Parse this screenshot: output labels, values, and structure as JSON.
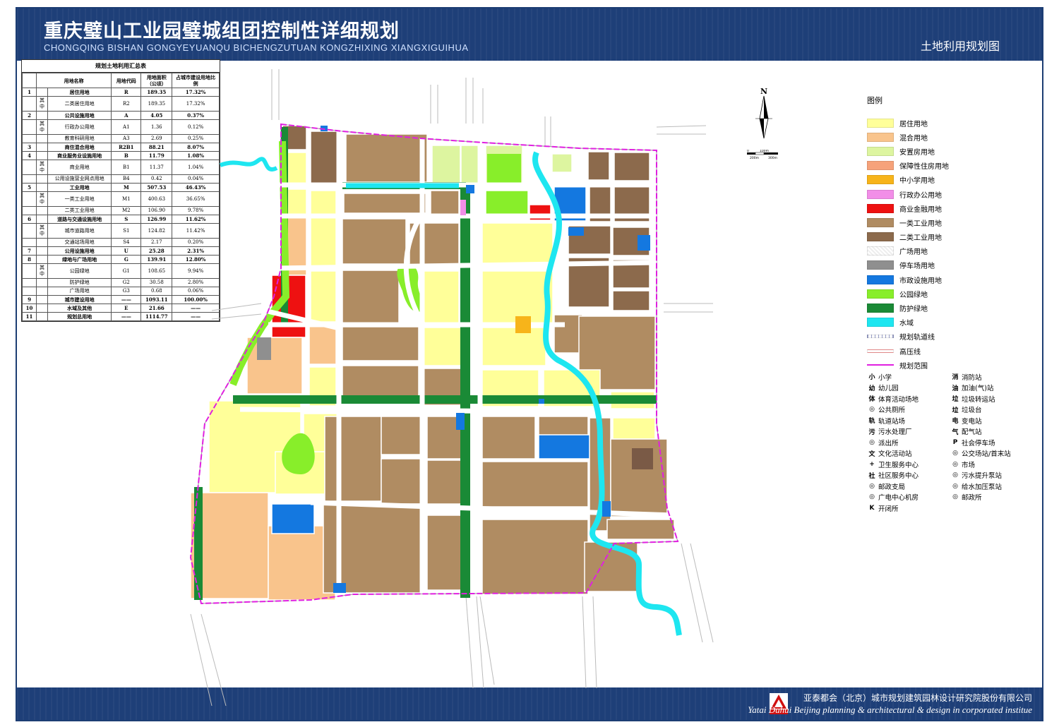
{
  "header": {
    "title_cn": "重庆璧山工业园璧城组团控制性详细规划",
    "title_en": "CHONGQING BISHAN GONGYEYUANQU BICHENGZUTUAN KONGZHIXING XIANGXIGUIHUA",
    "subtitle": "土地利用规划图"
  },
  "footer": {
    "org_cn": "亚泰都会（北京）城市规划建筑园林设计研究院股份有限公司",
    "org_en": "Yatai Duhui Beijing planning & architectural & design in corporated institue",
    "logo_text": "DUHUI"
  },
  "summary": {
    "caption": "规划土地利用汇总表",
    "headers": [
      "用地名称",
      "用地代码",
      "用地面积（公顷）",
      "占城市建设用地比例"
    ],
    "rows": [
      {
        "no": "1",
        "sub": "",
        "name": "居住用地",
        "code": "R",
        "area": "189.35",
        "ratio": "17.32%",
        "main": true
      },
      {
        "no": "",
        "sub": "其中",
        "name": "二类居住用地",
        "code": "R2",
        "area": "189.35",
        "ratio": "17.32%",
        "main": false
      },
      {
        "no": "2",
        "sub": "",
        "name": "公共设施用地",
        "code": "A",
        "area": "4.05",
        "ratio": "0.37%",
        "main": true
      },
      {
        "no": "",
        "sub": "其中",
        "name": "行政办公用地",
        "code": "A1",
        "area": "1.36",
        "ratio": "0.12%",
        "main": false
      },
      {
        "no": "",
        "sub": "",
        "name": "教育科研用地",
        "code": "A3",
        "area": "2.69",
        "ratio": "0.25%",
        "main": false
      },
      {
        "no": "3",
        "sub": "",
        "name": "商住混合用地",
        "code": "R2B1",
        "area": "88.21",
        "ratio": "8.07%",
        "main": true
      },
      {
        "no": "4",
        "sub": "",
        "name": "商业服务业设施用地",
        "code": "B",
        "area": "11.79",
        "ratio": "1.08%",
        "main": true
      },
      {
        "no": "",
        "sub": "其中",
        "name": "商业用地",
        "code": "B1",
        "area": "11.37",
        "ratio": "1.04%",
        "main": false
      },
      {
        "no": "",
        "sub": "",
        "name": "公用设施营业网点用地",
        "code": "B4",
        "area": "0.42",
        "ratio": "0.04%",
        "main": false
      },
      {
        "no": "5",
        "sub": "",
        "name": "工业用地",
        "code": "M",
        "area": "507.53",
        "ratio": "46.43%",
        "main": true
      },
      {
        "no": "",
        "sub": "其中",
        "name": "一类工业用地",
        "code": "M1",
        "area": "400.63",
        "ratio": "36.65%",
        "main": false
      },
      {
        "no": "",
        "sub": "",
        "name": "二类工业用地",
        "code": "M2",
        "area": "106.90",
        "ratio": "9.78%",
        "main": false
      },
      {
        "no": "6",
        "sub": "",
        "name": "道路与交通设施用地",
        "code": "S",
        "area": "126.99",
        "ratio": "11.62%",
        "main": true
      },
      {
        "no": "",
        "sub": "其中",
        "name": "城市道路用地",
        "code": "S1",
        "area": "124.82",
        "ratio": "11.42%",
        "main": false
      },
      {
        "no": "",
        "sub": "",
        "name": "交通站场用地",
        "code": "S4",
        "area": "2.17",
        "ratio": "0.20%",
        "main": false
      },
      {
        "no": "7",
        "sub": "",
        "name": "公用设施用地",
        "code": "U",
        "area": "25.28",
        "ratio": "2.31%",
        "main": true
      },
      {
        "no": "8",
        "sub": "",
        "name": "绿地与广场用地",
        "code": "G",
        "area": "139.91",
        "ratio": "12.80%",
        "main": true
      },
      {
        "no": "",
        "sub": "其中",
        "name": "公园绿地",
        "code": "G1",
        "area": "108.65",
        "ratio": "9.94%",
        "main": false
      },
      {
        "no": "",
        "sub": "",
        "name": "防护绿地",
        "code": "G2",
        "area": "30.58",
        "ratio": "2.80%",
        "main": false
      },
      {
        "no": "",
        "sub": "",
        "name": "广场用地",
        "code": "G3",
        "area": "0.68",
        "ratio": "0.06%",
        "main": false
      },
      {
        "no": "9",
        "sub": "",
        "name": "城市建设用地",
        "code": "——",
        "area": "1093.11",
        "ratio": "100.00%",
        "main": true
      },
      {
        "no": "10",
        "sub": "",
        "name": "水域及其他",
        "code": "E",
        "area": "21.66",
        "ratio": "——",
        "main": true
      },
      {
        "no": "11",
        "sub": "",
        "name": "规划总用地",
        "code": "——",
        "area": "1114.77",
        "ratio": "——",
        "main": true
      }
    ]
  },
  "legend": {
    "title": "图例",
    "items": [
      {
        "label": "居住用地",
        "color": "#ffff99"
      },
      {
        "label": "混合用地",
        "color": "#f9c48c"
      },
      {
        "label": "安置房用地",
        "color": "#ddf5a0"
      },
      {
        "label": "保障性住房用地",
        "color": "#f6a27a"
      },
      {
        "label": "中小学用地",
        "color": "#f7b41a"
      },
      {
        "label": "行政办公用地",
        "color": "#f28ee8"
      },
      {
        "label": "商业金融用地",
        "color": "#ee1111"
      },
      {
        "label": "一类工业用地",
        "color": "#b08c62"
      },
      {
        "label": "二类工业用地",
        "color": "#8c6a4c"
      },
      {
        "label": "广场用地",
        "color": "#e9e9e9"
      },
      {
        "label": "停车场用地",
        "color": "#8f8f8f"
      },
      {
        "label": "市政设施用地",
        "color": "#1478e0"
      },
      {
        "label": "公园绿地",
        "color": "#88ee2a"
      },
      {
        "label": "防护绿地",
        "color": "#1a8a36"
      },
      {
        "label": "水域",
        "color": "#1ee6f0"
      },
      {
        "label": "规划轨道线",
        "color": "#9aa0c8"
      },
      {
        "label": "高压线",
        "color": "#e08888"
      },
      {
        "label": "规划范围",
        "color": "#e020e0"
      }
    ],
    "symbols": [
      [
        "小",
        "小学",
        "消",
        "消防站"
      ],
      [
        "幼",
        "幼儿园",
        "油",
        "加油(气)站"
      ],
      [
        "体",
        "体育活动场地",
        "垃",
        "垃圾转运站"
      ],
      [
        "",
        "公共厕所",
        "垃",
        "垃圾台"
      ],
      [
        "轨",
        "轨道站场",
        "电",
        "变电站"
      ],
      [
        "污",
        "污水处理厂",
        "气",
        "配气站"
      ],
      [
        "",
        "派出所",
        "P",
        "社会停车场"
      ],
      [
        "文",
        "文化活动站",
        "",
        "公交场站/首末站"
      ],
      [
        "+",
        "卫生服务中心",
        "",
        "市场"
      ],
      [
        "社",
        "社区服务中心",
        "",
        "污水提升泵站"
      ],
      [
        "",
        "邮政支局",
        "",
        "给水加压泵站"
      ],
      [
        "",
        "广电中心机房",
        "",
        "邮政所"
      ],
      [
        "K",
        "开闭所",
        "",
        ""
      ]
    ]
  },
  "map": {
    "compass": "N",
    "scale": [
      "0",
      "100m",
      "200m",
      "300m"
    ],
    "colors": {
      "residential": "#ffff99",
      "mixed": "#f9c48c",
      "resettle": "#ddf5a0",
      "school": "#f7b41a",
      "admin": "#f28ee8",
      "commerce": "#ee1111",
      "ind1": "#b08c62",
      "ind2": "#8c6a4c",
      "park": "#88ee2a",
      "buffer": "#1a8a36",
      "water": "#1ee6f0",
      "utility": "#1478e0",
      "parking": "#8f8f8f",
      "boundary": "#e020e0",
      "road": "#ffffff"
    }
  }
}
